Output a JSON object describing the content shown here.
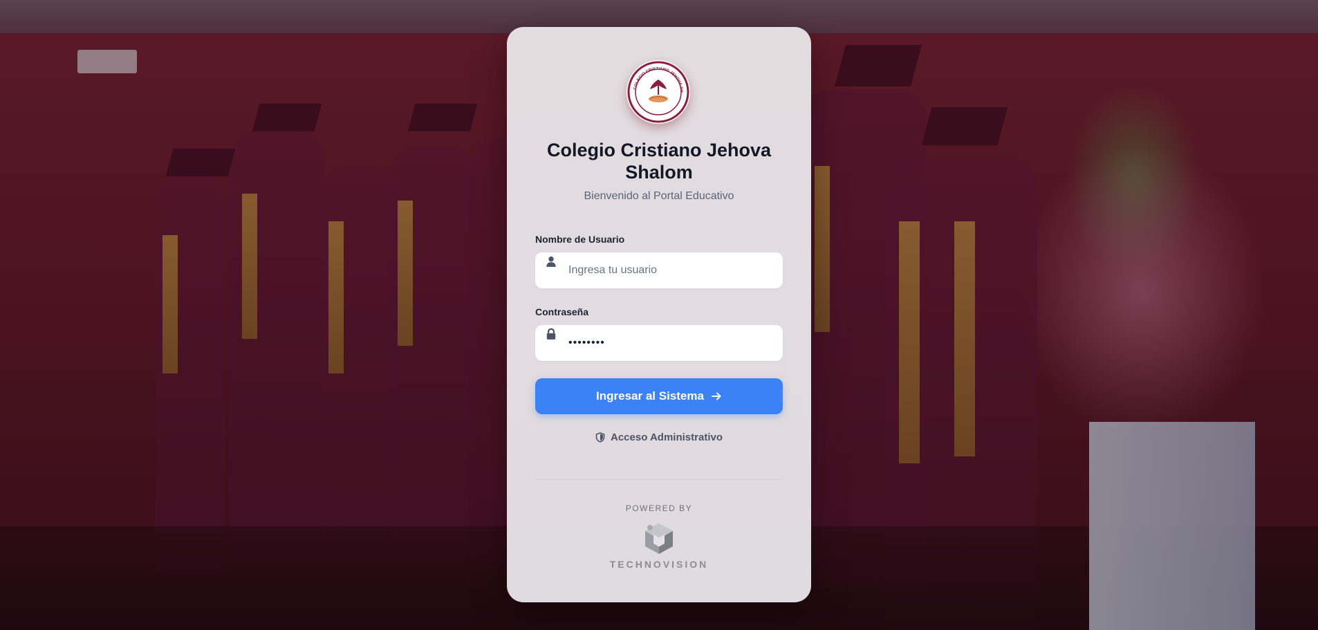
{
  "header": {
    "school_name": "Colegio Cristiano Jehova Shalom",
    "welcome": "Bienvenido al Portal Educativo"
  },
  "form": {
    "username_label": "Nombre de Usuario",
    "username_placeholder": "Ingresa tu usuario",
    "username_value": "",
    "password_label": "Contraseña",
    "password_value": "••••••••",
    "submit_label": "Ingresar al Sistema",
    "admin_link_label": "Acceso Administrativo"
  },
  "footer": {
    "powered_by": "POWERED BY",
    "brand": "TECHNOVISION"
  },
  "logo": {
    "seal_text": "COLEGIO CRISTIANO JEHOVA SHALOM"
  },
  "colors": {
    "primary_button": "#3b82f6",
    "title": "#121826",
    "background_maroon": "#5a1524",
    "card": "#e8e4e7"
  },
  "icons": {
    "username": "user-icon",
    "password": "lock-icon",
    "submit": "arrow-right-icon",
    "admin": "shield-icon"
  }
}
